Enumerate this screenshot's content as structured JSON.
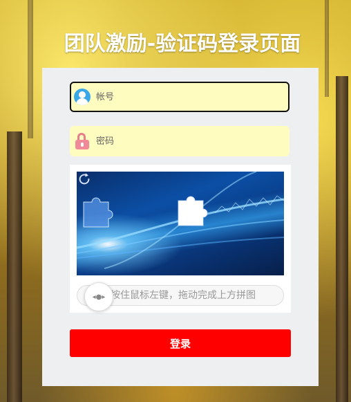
{
  "page": {
    "title": "团队激励-验证码登录页面"
  },
  "form": {
    "username_placeholder": "帐号",
    "username_value": "",
    "password_placeholder": "密码",
    "password_value": "",
    "login_label": "登录"
  },
  "captcha": {
    "slider_hint": "按住鼠标左键，拖动完成上方拼图",
    "slider_handle_glyph": "◂●▸"
  },
  "icons": {
    "username": "user-icon",
    "password": "lock-icon",
    "refresh": "refresh-icon"
  },
  "colors": {
    "login_button": "#ff0000",
    "input_bg": "#fffcc0",
    "panel_bg": "#eeeff1"
  }
}
